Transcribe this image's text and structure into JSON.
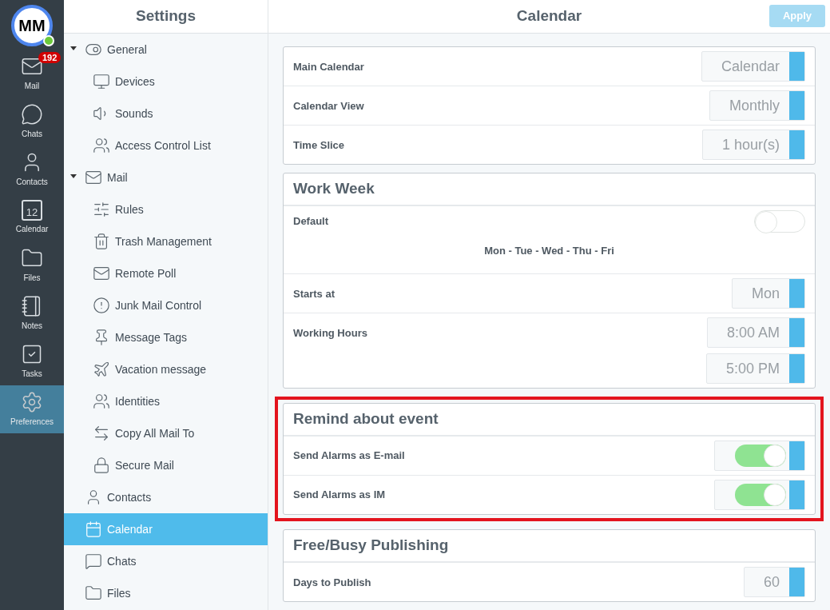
{
  "avatar": {
    "initials": "MM",
    "online": true
  },
  "nav": [
    {
      "label": "Mail",
      "badge": "192",
      "selected": false
    },
    {
      "label": "Chats",
      "selected": false
    },
    {
      "label": "Contacts",
      "selected": false
    },
    {
      "label": "Calendar",
      "icon_text": "12",
      "selected": false
    },
    {
      "label": "Files",
      "selected": false
    },
    {
      "label": "Notes",
      "selected": false
    },
    {
      "label": "Tasks",
      "selected": false
    },
    {
      "label": "Preferences",
      "selected": true
    }
  ],
  "settings": {
    "title": "Settings",
    "items": [
      {
        "label": "General",
        "expanded": true,
        "selected": false,
        "children": [
          {
            "label": "Devices",
            "selected": false
          },
          {
            "label": "Sounds",
            "selected": false
          },
          {
            "label": "Access Control List",
            "selected": false
          }
        ]
      },
      {
        "label": "Mail",
        "expanded": true,
        "selected": false,
        "children": [
          {
            "label": "Rules",
            "selected": false
          },
          {
            "label": "Trash Management",
            "selected": false
          },
          {
            "label": "Remote Poll",
            "selected": false
          },
          {
            "label": "Junk Mail Control",
            "selected": false
          },
          {
            "label": "Message Tags",
            "selected": false
          },
          {
            "label": "Vacation message",
            "selected": false
          },
          {
            "label": "Identities",
            "selected": false
          },
          {
            "label": "Copy All Mail To",
            "selected": false
          },
          {
            "label": "Secure Mail",
            "selected": false
          }
        ]
      },
      {
        "label": "Contacts",
        "selected": false
      },
      {
        "label": "Calendar",
        "selected": true
      },
      {
        "label": "Chats",
        "selected": false
      },
      {
        "label": "Files",
        "selected": false
      }
    ]
  },
  "page": {
    "title": "Calendar",
    "apply": {
      "label": "Apply",
      "disabled": true
    }
  },
  "sections": [
    {
      "highlighted": false,
      "rows": [
        {
          "kind": "select",
          "label": "Main Calendar",
          "values": [
            "Calendar"
          ]
        },
        {
          "kind": "select",
          "label": "Calendar View",
          "values": [
            "Monthly"
          ]
        },
        {
          "kind": "select",
          "label": "Time Slice",
          "values": [
            "1 hour(s)"
          ]
        }
      ]
    },
    {
      "title": "Work Week",
      "highlighted": false,
      "rows": [
        {
          "kind": "switch",
          "label": "Default",
          "on": false,
          "note": "Mon - Tue - Wed - Thu - Fri"
        },
        {
          "kind": "select",
          "label": "Starts at",
          "values": [
            "Mon"
          ]
        },
        {
          "kind": "select",
          "label": "Working Hours",
          "values": [
            "8:00 AM",
            "5:00 PM"
          ]
        }
      ]
    },
    {
      "title": "Remind about event",
      "highlighted": true,
      "rows": [
        {
          "kind": "boxed_switch",
          "label": "Send Alarms as E-mail",
          "on": true
        },
        {
          "kind": "boxed_switch",
          "label": "Send Alarms as IM",
          "on": true
        }
      ]
    },
    {
      "title": "Free/Busy Publishing",
      "highlighted": false,
      "rows": [
        {
          "kind": "select",
          "label": "Days to Publish",
          "values": [
            "60"
          ]
        }
      ]
    }
  ]
}
